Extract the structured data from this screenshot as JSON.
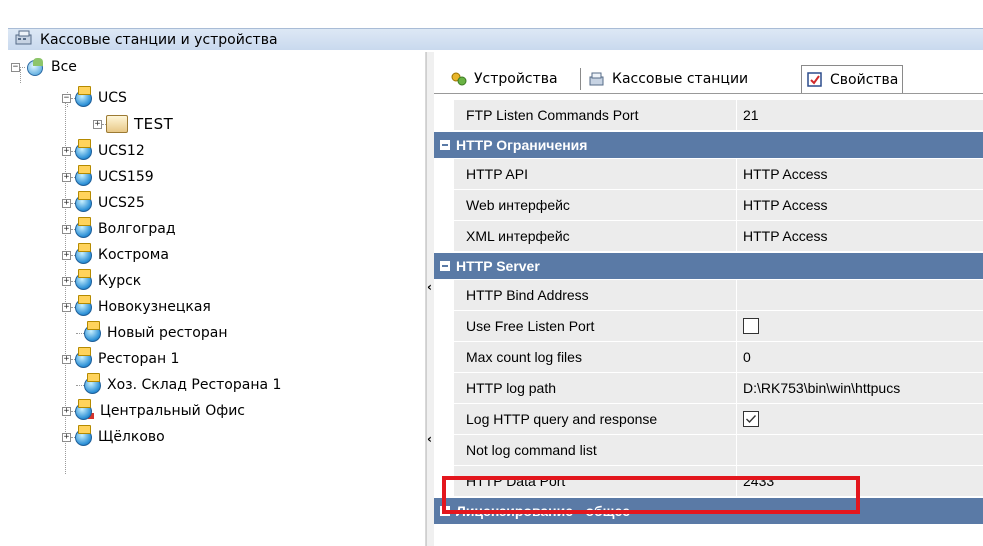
{
  "window": {
    "title": "Кассовые станции и устройства"
  },
  "tree": {
    "root": "Все",
    "nodes": [
      {
        "label": "UCS"
      },
      {
        "label": "TEST"
      },
      {
        "label": "UCS12"
      },
      {
        "label": "UCS159"
      },
      {
        "label": "UCS25"
      },
      {
        "label": "Волгоград"
      },
      {
        "label": "Кострома"
      },
      {
        "label": "Курск"
      },
      {
        "label": "Новокузнецкая"
      },
      {
        "label": "Новый ресторан"
      },
      {
        "label": "Ресторан 1"
      },
      {
        "label": "Хоз. Склад Ресторана 1"
      },
      {
        "label": "Центральный Офис"
      },
      {
        "label": "Щёлково"
      }
    ]
  },
  "tabs": [
    {
      "label": "Устройства",
      "icon": "devices-icon"
    },
    {
      "label": "Кассовые станции",
      "icon": "cash-stations-icon"
    },
    {
      "label": "Свойства",
      "icon": "properties-icon",
      "active": true
    }
  ],
  "properties": {
    "ftp_listen_port": {
      "name": "FTP Listen Commands Port",
      "value": "21"
    },
    "cat_http_limits": "HTTP Ограничения",
    "http_api": {
      "name": "HTTP API",
      "value": "HTTP Access"
    },
    "web_interface": {
      "name": "Web интерфейс",
      "value": "HTTP Access"
    },
    "xml_interface": {
      "name": "XML интерфейс",
      "value": "HTTP Access"
    },
    "cat_http_server": "HTTP Server",
    "http_bind_address": {
      "name": "HTTP Bind Address",
      "value": ""
    },
    "use_free_listen_port": {
      "name": "Use Free Listen Port",
      "checked": false
    },
    "max_count_log_files": {
      "name": "Max count log files",
      "value": "0"
    },
    "http_log_path": {
      "name": "HTTP log path",
      "value": "D:\\RK753\\bin\\win\\httpucs"
    },
    "log_http_query": {
      "name": "Log HTTP query and response",
      "checked": true
    },
    "not_log_command_list": {
      "name": "Not log command list",
      "value": ""
    },
    "http_data_port": {
      "name": "HTTP Data Port",
      "value": "2433"
    },
    "cat_licensing": "Лицензирование - общее"
  },
  "colors": {
    "category_bg": "#5a7aa6",
    "highlight": "#e3161d",
    "row_bg": "#ececec"
  }
}
